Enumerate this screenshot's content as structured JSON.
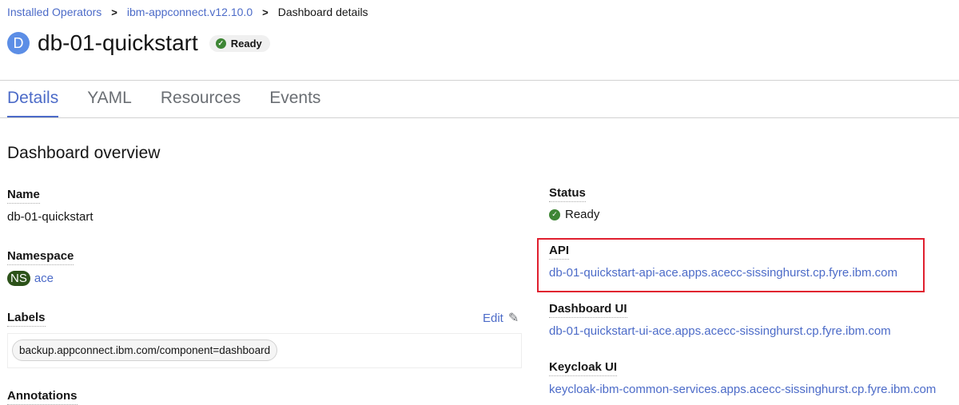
{
  "breadcrumb": [
    "Installed Operators",
    "ibm-appconnect.v12.10.0",
    "Dashboard details"
  ],
  "header": {
    "badge": "D",
    "title": "db-01-quickstart",
    "status": "Ready"
  },
  "tabs": [
    "Details",
    "YAML",
    "Resources",
    "Events"
  ],
  "section_title": "Dashboard overview",
  "left": {
    "name_label": "Name",
    "name_value": "db-01-quickstart",
    "namespace_label": "Namespace",
    "ns_badge": "NS",
    "namespace_value": "ace",
    "labels_label": "Labels",
    "edit_label": "Edit",
    "label_chip": "backup.appconnect.ibm.com/component=dashboard",
    "annotations_label": "Annotations"
  },
  "right": {
    "status_label": "Status",
    "status_value": "Ready",
    "api_label": "API",
    "api_value": "db-01-quickstart-api-ace.apps.acecc-sissinghurst.cp.fyre.ibm.com",
    "dash_label": "Dashboard UI",
    "dash_value": "db-01-quickstart-ui-ace.apps.acecc-sissinghurst.cp.fyre.ibm.com",
    "keycloak_label": "Keycloak UI",
    "keycloak_value": "keycloak-ibm-common-services.apps.acecc-sissinghurst.cp.fyre.ibm.com"
  }
}
